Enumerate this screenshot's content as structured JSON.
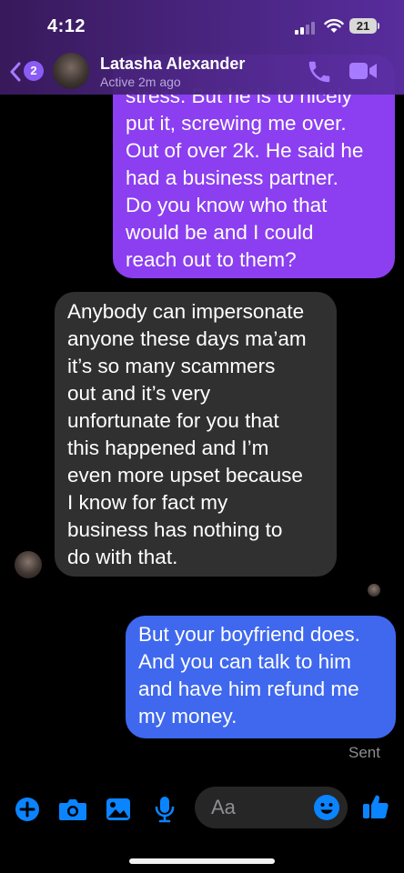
{
  "status_bar": {
    "time": "4:12",
    "battery": "21"
  },
  "header": {
    "back_badge": "2",
    "contact_name": "Latasha Alexander",
    "contact_status": "Active 2m ago",
    "call_icon": "phone-icon",
    "video_icon": "video-camera-icon"
  },
  "messages": [
    {
      "direction": "outgoing",
      "text": "stress. But he is to nicely\nput it, screwing me over.\nOut of over 2k. He said he\nhad a business partner.\nDo you know who that\nwould be and I could\nreach out to them?"
    },
    {
      "direction": "incoming",
      "text": "Anybody can impersonate\nanyone these days ma’am\nit’s so many scammers\nout and it’s very\nunfortunate for you that\nthis happened and I’m\neven more upset because\nI know for fact my\nbusiness has nothing to\ndo with that."
    },
    {
      "direction": "outgoing",
      "text": "But your boyfriend does.\nAnd you can talk to him\nand have him refund me\nmy money."
    }
  ],
  "delivery_status": "Sent",
  "composer": {
    "placeholder": "Aa",
    "icons": [
      "plus-circle-icon",
      "camera-icon",
      "gallery-icon",
      "microphone-icon",
      "emoji-icon",
      "thumbs-up-icon"
    ]
  },
  "colors": {
    "outgoing_purple": "#8b3ff0",
    "outgoing_blue": "#3f68ee",
    "incoming_gray": "#303030",
    "accent_blue": "#0a84ff",
    "header_purple": "#4a2580"
  }
}
